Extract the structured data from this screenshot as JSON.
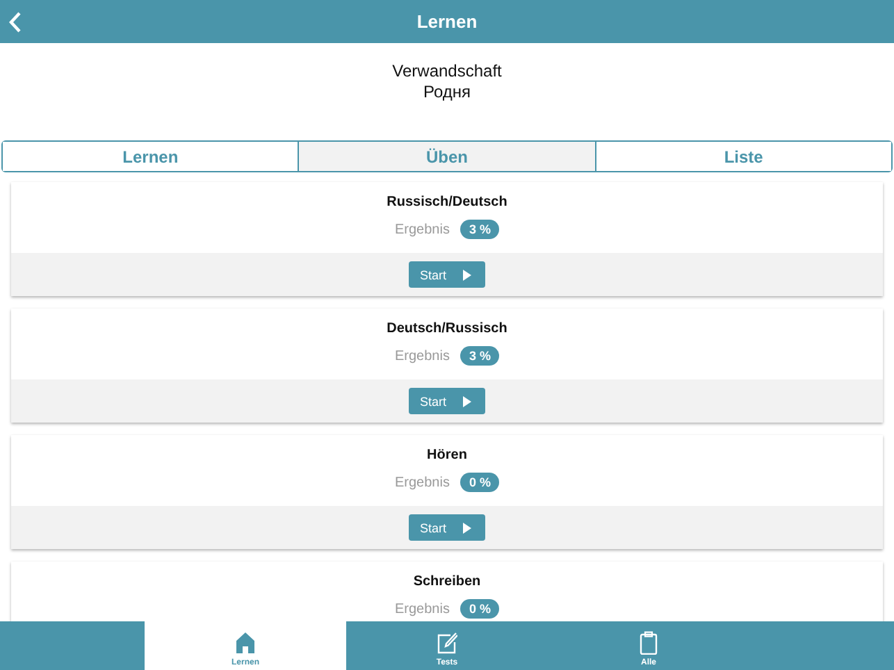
{
  "header": {
    "title": "Lernen"
  },
  "topic": {
    "title": "Verwandschaft",
    "subtitle": "Родня"
  },
  "segments": [
    {
      "label": "Lernen",
      "selected": false
    },
    {
      "label": "Üben",
      "selected": true
    },
    {
      "label": "Liste",
      "selected": false
    }
  ],
  "exercises": [
    {
      "title": "Russisch/Deutsch",
      "result_label": "Ergebnis",
      "result": "3 %",
      "button": "Start"
    },
    {
      "title": "Deutsch/Russisch",
      "result_label": "Ergebnis",
      "result": "3 %",
      "button": "Start"
    },
    {
      "title": "Hören",
      "result_label": "Ergebnis",
      "result": "0 %",
      "button": "Start"
    },
    {
      "title": "Schreiben",
      "result_label": "Ergebnis",
      "result": "0 %"
    }
  ],
  "tab_bar": [
    {
      "label": "Lernen",
      "kind": "home",
      "selected": true
    },
    {
      "label": "Tests",
      "kind": "edit",
      "selected": false
    },
    {
      "label": "Alle",
      "kind": "clipboard",
      "selected": false
    }
  ]
}
